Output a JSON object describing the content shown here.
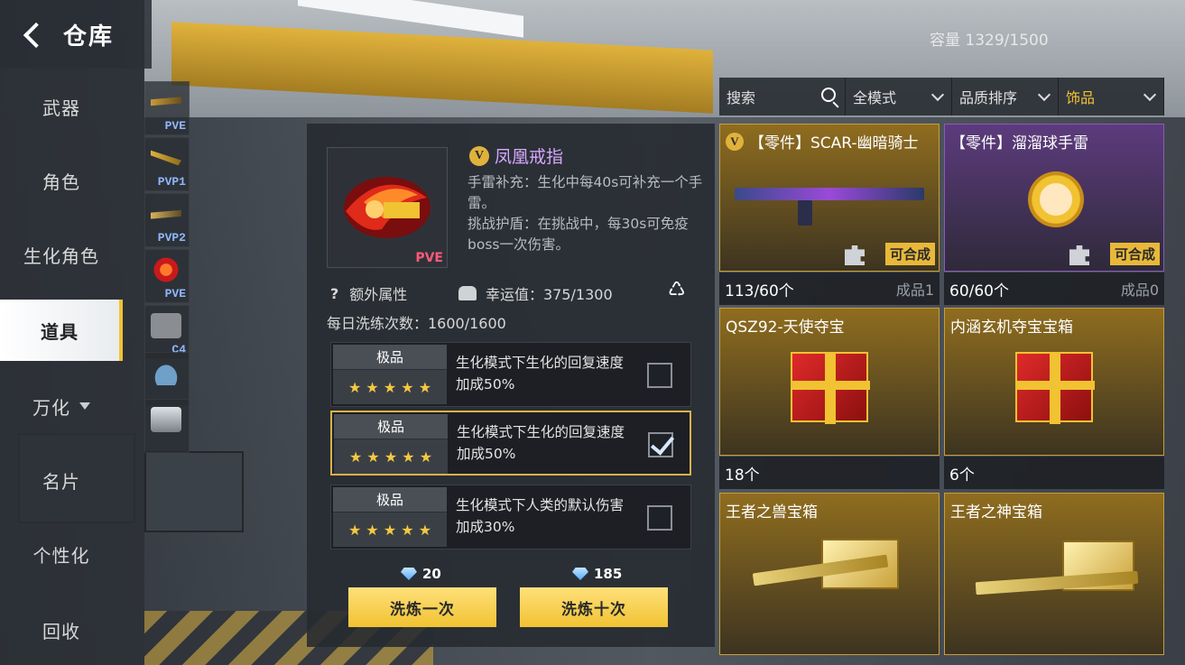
{
  "header": {
    "title": "仓库",
    "capacity": "容量 1329/1500"
  },
  "leftnav": {
    "items": [
      {
        "label": "武器"
      },
      {
        "label": "角色"
      },
      {
        "label": "生化角色"
      },
      {
        "label": "道具",
        "active": true
      },
      {
        "label": "万化"
      },
      {
        "label": "名片"
      },
      {
        "label": "个性化"
      },
      {
        "label": "回收"
      }
    ]
  },
  "categories": [
    {
      "label": "PVE"
    },
    {
      "label": "PVP1"
    },
    {
      "label": "PVP2"
    },
    {
      "label": "PVE"
    },
    {
      "label": "C4"
    },
    {
      "label": ""
    },
    {
      "label": ""
    }
  ],
  "detail": {
    "name": "凤凰戒指",
    "thumb_tag": "PVE",
    "desc1": "手雷补充：生化中每40s可补充一个手雷。",
    "desc2": "挑战护盾：在挑战中，每30s可免疫boss一次伤害。",
    "extra_label": "额外属性",
    "luck": "幸运值：375/1300",
    "daily": "每日洗练次数：1600/1600",
    "rolls": [
      {
        "quality": "极品",
        "stars": "★ ★ ★ ★ ★",
        "text": "生化模式下生化的回复速度加成50%",
        "checked": false
      },
      {
        "quality": "极品",
        "stars": "★ ★ ★ ★ ★",
        "text": "生化模式下生化的回复速度加成50%",
        "checked": true
      },
      {
        "quality": "极品",
        "stars": "★ ★ ★ ★ ★",
        "text": "生化模式下人类的默认伤害加成30%",
        "checked": false
      }
    ],
    "cost_one": "20",
    "cost_ten": "185",
    "btn_one": "洗炼一次",
    "btn_ten": "洗炼十次"
  },
  "filters": {
    "search_placeholder": "搜索",
    "mode": "全模式",
    "sort": "品质排序",
    "category": "饰品"
  },
  "cards": [
    {
      "title": "【零件】SCAR-幽暗骑士",
      "craft": "可合成",
      "count": "113/60个",
      "sub": "成品1"
    },
    {
      "title": "【零件】溜溜球手雷",
      "craft": "可合成",
      "count": "60/60个",
      "sub": "成品0"
    },
    {
      "title": "QSZ92-天使夺宝",
      "count": "18个"
    },
    {
      "title": "内涵玄机夺宝宝箱",
      "count": "6个"
    },
    {
      "title": "王者之兽宝箱"
    },
    {
      "title": "王者之神宝箱"
    }
  ],
  "colors": {
    "accent": "#f1c232",
    "rare_purple": "#d7a7ff",
    "gold_card": "#8f6d1f"
  }
}
